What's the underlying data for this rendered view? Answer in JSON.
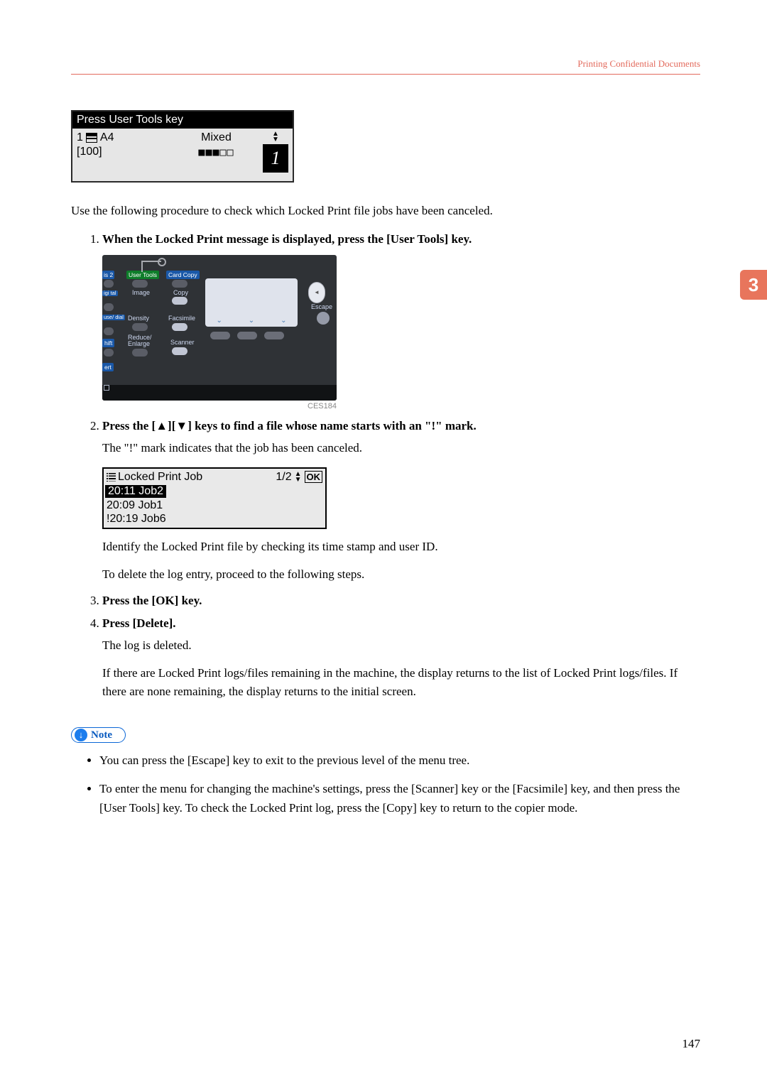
{
  "header": {
    "section": "Printing Confidential Documents"
  },
  "sideTab": "3",
  "lcd1": {
    "title": "Press User Tools key",
    "trayNum": "1",
    "paperSize": "A4",
    "word_mixed": "Mixed",
    "valueBracket": "[100]",
    "blocks": "■■■□□",
    "bigOne": "1"
  },
  "intro": "Use the following procedure to check which Locked Print file jobs have been canceled.",
  "step1": {
    "text": "When the Locked Print message is displayed, press the [User Tools] key.",
    "panel": {
      "userTools": "User Tools",
      "image": "Image",
      "density": "Density",
      "reduceEnlarge": "Reduce/\nEnlarge",
      "cardCopy": "Card Copy",
      "copy": "Copy",
      "facsimile": "Facsimile",
      "scanner": "Scanner",
      "escape": "Escape",
      "leftCut": {
        "a": "is 2",
        "b": "igi\ntal",
        "c": "use/\ndial",
        "d": "hift",
        "e": "ert"
      }
    },
    "refCode": "CES184"
  },
  "step2": {
    "text": "Press the [▲][▼] keys to find a file whose name starts with an \"!\" mark.",
    "para1": "The \"!\" mark indicates that the job has been canceled.",
    "lcd": {
      "title": "Locked Print Job",
      "page": "1/2",
      "ok": "OK",
      "rows": [
        "20:11 Job2",
        "20:09 Job1",
        "!20:19 Job6"
      ]
    },
    "para2": "Identify the Locked Print file by checking its time stamp and user ID.",
    "para3": "To delete the log entry, proceed to the following steps."
  },
  "step3": {
    "text": "Press the [OK] key."
  },
  "step4": {
    "text": "Press [Delete].",
    "para1": "The log is deleted.",
    "para2": "If there are Locked Print logs/files remaining in the machine, the display returns to the list of Locked Print logs/files. If there are none remaining, the display returns to the initial screen."
  },
  "note": {
    "label": "Note",
    "items": [
      "You can press the [Escape] key to exit to the previous level of the menu tree.",
      "To enter the menu for changing the machine's settings, press the [Scanner] key or the [Facsimile] key, and then press the [User Tools] key. To check the Locked Print log, press the [Copy] key to return to the copier mode."
    ]
  },
  "pageNumber": "147"
}
